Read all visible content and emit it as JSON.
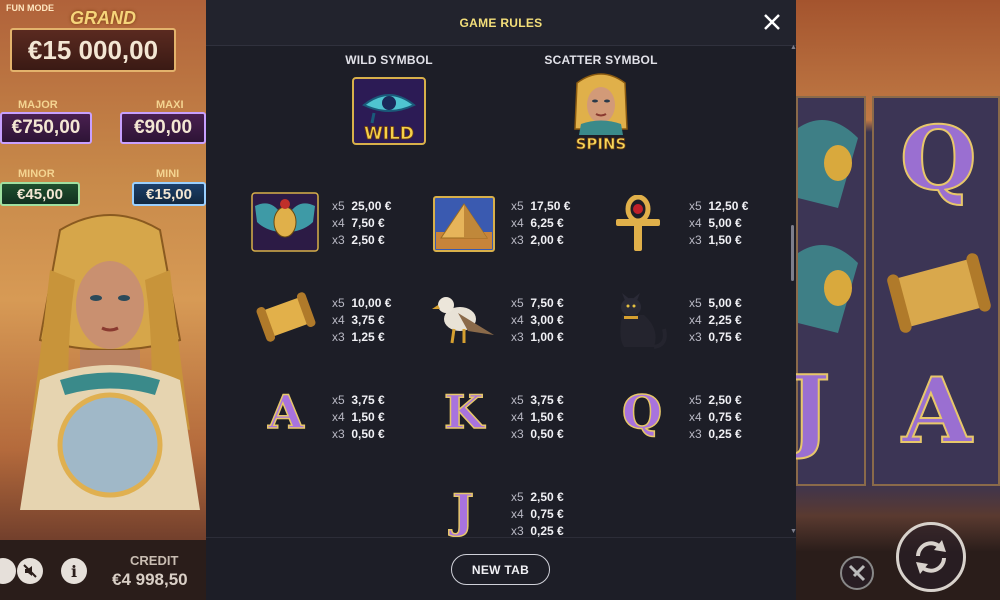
{
  "game_bg": {
    "fun_mode": "FUN MODE",
    "grand_label": "GRAND",
    "grand_value": "€15 000,00",
    "major_label": "MAJOR",
    "major_value": "€750,00",
    "maxi_label": "MAXI",
    "maxi_value": "€90,00",
    "minor_label": "MINOR",
    "minor_value": "€45,00",
    "mini_label": "MINI",
    "mini_value": "€15,00",
    "credit_label": "CREDIT",
    "credit_value": "€4 998,50",
    "info_icon_glyph": "i"
  },
  "reels": {
    "letters": [
      "Q",
      "J",
      "A"
    ]
  },
  "modal": {
    "title": "GAME RULES",
    "close_icon": "close-icon",
    "wild_label": "WILD SYMBOL",
    "scatter_label": "SCATTER SYMBOL",
    "wild_text": "WILD",
    "scatter_text": "SPINS",
    "new_tab_label": "NEW TAB"
  },
  "paytable": [
    {
      "symbol": "scarab",
      "rows": [
        {
          "m": "x5",
          "v": "25,00 €"
        },
        {
          "m": "x4",
          "v": "7,50 €"
        },
        {
          "m": "x3",
          "v": "2,50 €"
        }
      ]
    },
    {
      "symbol": "pyramid",
      "rows": [
        {
          "m": "x5",
          "v": "17,50 €"
        },
        {
          "m": "x4",
          "v": "6,25 €"
        },
        {
          "m": "x3",
          "v": "2,00 €"
        }
      ]
    },
    {
      "symbol": "ankh",
      "rows": [
        {
          "m": "x5",
          "v": "12,50 €"
        },
        {
          "m": "x4",
          "v": "5,00 €"
        },
        {
          "m": "x3",
          "v": "1,50 €"
        }
      ]
    },
    {
      "symbol": "scroll",
      "rows": [
        {
          "m": "x5",
          "v": "10,00 €"
        },
        {
          "m": "x4",
          "v": "3,75 €"
        },
        {
          "m": "x3",
          "v": "1,25 €"
        }
      ]
    },
    {
      "symbol": "falcon",
      "rows": [
        {
          "m": "x5",
          "v": "7,50 €"
        },
        {
          "m": "x4",
          "v": "3,00 €"
        },
        {
          "m": "x3",
          "v": "1,00 €"
        }
      ]
    },
    {
      "symbol": "cat",
      "rows": [
        {
          "m": "x5",
          "v": "5,00 €"
        },
        {
          "m": "x4",
          "v": "2,25 €"
        },
        {
          "m": "x3",
          "v": "0,75 €"
        }
      ]
    },
    {
      "symbol": "A",
      "rows": [
        {
          "m": "x5",
          "v": "3,75 €"
        },
        {
          "m": "x4",
          "v": "1,50 €"
        },
        {
          "m": "x3",
          "v": "0,50 €"
        }
      ]
    },
    {
      "symbol": "K",
      "rows": [
        {
          "m": "x5",
          "v": "3,75 €"
        },
        {
          "m": "x4",
          "v": "1,50 €"
        },
        {
          "m": "x3",
          "v": "0,50 €"
        }
      ]
    },
    {
      "symbol": "Q",
      "rows": [
        {
          "m": "x5",
          "v": "2,50 €"
        },
        {
          "m": "x4",
          "v": "0,75 €"
        },
        {
          "m": "x3",
          "v": "0,25 €"
        }
      ]
    },
    {
      "symbol": "J",
      "rows": [
        {
          "m": "x5",
          "v": "2,50 €"
        },
        {
          "m": "x4",
          "v": "0,75 €"
        },
        {
          "m": "x3",
          "v": "0,25 €"
        }
      ]
    }
  ],
  "colors": {
    "title_yellow": "#f4df7a",
    "panel_bg": "#1d1e27",
    "letter_purple": "#a873de",
    "gold": "#e6c76a"
  }
}
